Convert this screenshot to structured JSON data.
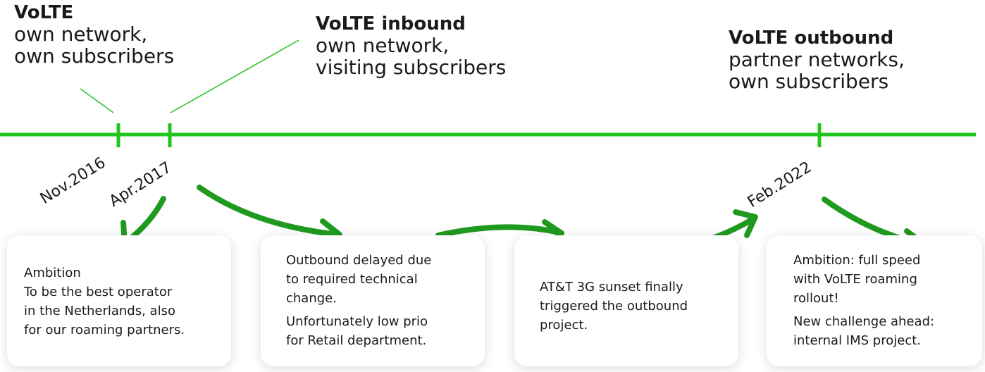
{
  "milestones": [
    {
      "title": "VoLTE",
      "subtitle_line1": "own network,",
      "subtitle_line2": "own subscribers",
      "date": "Nov.2016"
    },
    {
      "title": "VoLTE inbound",
      "subtitle_line1": "own network,",
      "subtitle_line2": "visiting subscribers",
      "date": "Apr.2017"
    },
    {
      "title": "VoLTE outbound",
      "subtitle_line1": "partner networks,",
      "subtitle_line2": "own subscribers",
      "date": "Feb.2022"
    }
  ],
  "cards": [
    {
      "lines": [
        "Ambition",
        "To be the best operator",
        "in the Netherlands, also",
        "for our roaming partners."
      ]
    },
    {
      "p1": [
        "Outbound delayed due",
        "to required technical",
        "change."
      ],
      "p2": [
        "Unfortunately low prio",
        "for Retail department."
      ]
    },
    {
      "lines": [
        "AT&T 3G sunset finally",
        "triggered the outbound",
        "project."
      ]
    },
    {
      "p1": [
        "Ambition: full speed",
        "with VoLTE roaming",
        "rollout!"
      ],
      "p2": [
        "New challenge ahead:",
        "internal IMS project."
      ]
    }
  ],
  "colors": {
    "timeline": "#22c41e",
    "arrow": "#1f9a1f",
    "callout_line": "#22c41e"
  }
}
